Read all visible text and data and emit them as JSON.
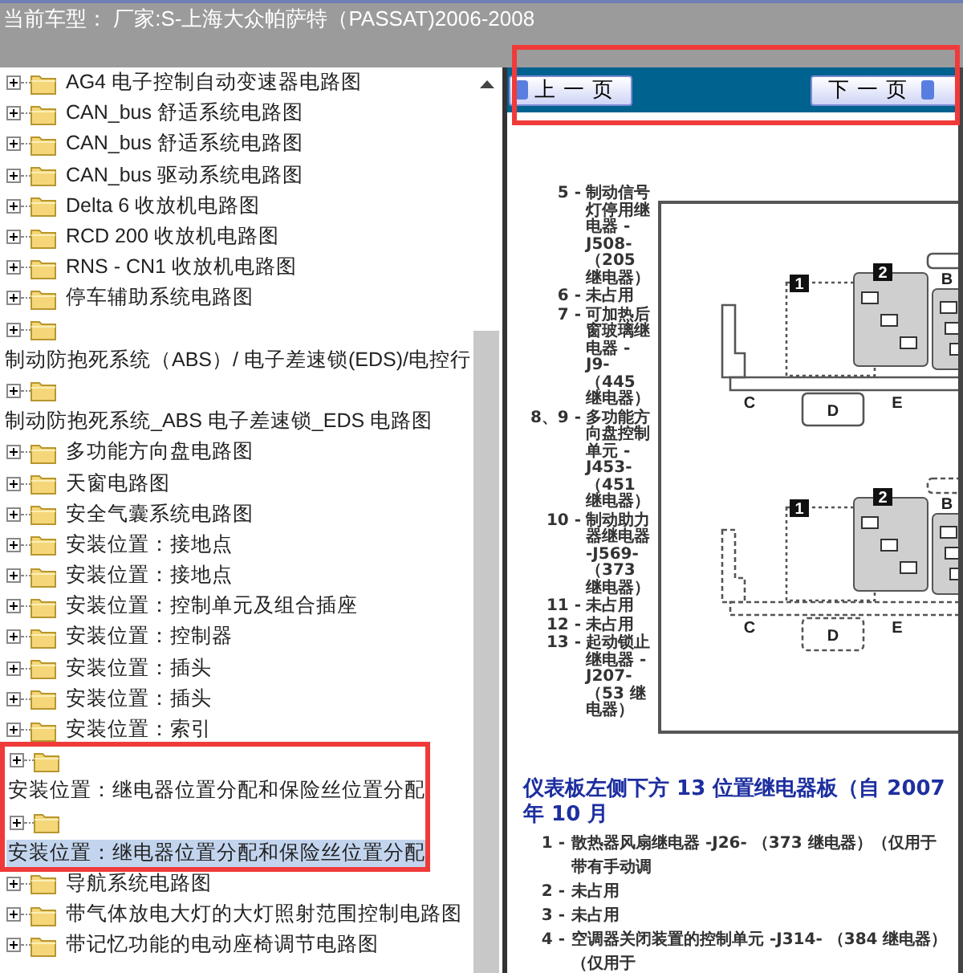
{
  "header": {
    "title": "当前车型： 厂家:S-上海大众帕萨特（PASSAT)2006-2008"
  },
  "tree": {
    "items": [
      {
        "label": "AG4 电子控制自动变速器电路图",
        "kind": "inline",
        "selected": false,
        "annotated": false
      },
      {
        "label": "CAN_bus 舒适系统电路图",
        "kind": "inline",
        "selected": false,
        "annotated": false
      },
      {
        "label": "CAN_bus 舒适系统电路图",
        "kind": "inline",
        "selected": false,
        "annotated": false
      },
      {
        "label": "CAN_bus 驱动系统电路图",
        "kind": "inline",
        "selected": false,
        "annotated": false
      },
      {
        "label": "Delta 6 收放机电路图",
        "kind": "inline",
        "selected": false,
        "annotated": false
      },
      {
        "label": "RCD 200 收放机电路图",
        "kind": "inline",
        "selected": false,
        "annotated": false
      },
      {
        "label": "RNS - CN1 收放机电路图",
        "kind": "inline",
        "selected": false,
        "annotated": false
      },
      {
        "label": "停车辅助系统电路图",
        "kind": "inline",
        "selected": false,
        "annotated": false
      },
      {
        "label": "制动防抱死系统（ABS）/ 电子差速锁(EDS)/电控行",
        "kind": "wrapped",
        "selected": false,
        "annotated": false
      },
      {
        "label": "制动防抱死系统_ABS 电子差速锁_EDS 电路图",
        "kind": "wrapped",
        "selected": false,
        "annotated": false
      },
      {
        "label": "多功能方向盘电路图",
        "kind": "inline",
        "selected": false,
        "annotated": false
      },
      {
        "label": "天窗电路图",
        "kind": "inline",
        "selected": false,
        "annotated": false
      },
      {
        "label": "安全气囊系统电路图",
        "kind": "inline",
        "selected": false,
        "annotated": false
      },
      {
        "label": "安装位置：接地点",
        "kind": "inline",
        "selected": false,
        "annotated": false
      },
      {
        "label": "安装位置：接地点",
        "kind": "inline",
        "selected": false,
        "annotated": false
      },
      {
        "label": "安装位置：控制单元及组合插座",
        "kind": "inline",
        "selected": false,
        "annotated": false
      },
      {
        "label": "安装位置：控制器",
        "kind": "inline",
        "selected": false,
        "annotated": false
      },
      {
        "label": "安装位置：插头",
        "kind": "inline",
        "selected": false,
        "annotated": false
      },
      {
        "label": "安装位置：插头",
        "kind": "inline",
        "selected": false,
        "annotated": false
      },
      {
        "label": "安装位置：索引",
        "kind": "inline",
        "selected": false,
        "annotated": false
      },
      {
        "label": "安装位置：继电器位置分配和保险丝位置分配",
        "kind": "wrapped",
        "selected": false,
        "annotated": true
      },
      {
        "label": "安装位置：继电器位置分配和保险丝位置分配",
        "kind": "wrapped",
        "selected": true,
        "annotated": true
      },
      {
        "label": "导航系统电路图",
        "kind": "inline",
        "selected": false,
        "annotated": false
      },
      {
        "label": "带气体放电大灯的大灯照射范围控制电路图",
        "kind": "inline",
        "selected": false,
        "annotated": false
      },
      {
        "label": "带记忆功能的电动座椅调节电路图",
        "kind": "inline",
        "selected": false,
        "annotated": false
      }
    ]
  },
  "viewer": {
    "toolbar": {
      "annotated": true,
      "buttons": [
        {
          "label": "上一页",
          "kind": "prev"
        },
        {
          "label": "下一页",
          "kind": "next"
        }
      ]
    },
    "legend": [
      {
        "number": "5 -",
        "text": "制动信号灯停用继电器 - J508- （205 继电器）"
      },
      {
        "number": "6 -",
        "text": "未占用"
      },
      {
        "number": "7 -",
        "text": "可加热后窗玻璃继电器 -J9- （445 继电器）"
      },
      {
        "number": "8、9 -",
        "text": "多功能方向盘控制单元 - J453- （451 继电器）"
      },
      {
        "number": "10 -",
        "text": "制动助力器继电器 -J569- （373 继电器）"
      },
      {
        "number": "11 -",
        "text": "未占用"
      },
      {
        "number": "12 -",
        "text": "未占用"
      },
      {
        "number": "13 -",
        "text": "起动锁止继电器 - J207- （53 继电器）"
      }
    ],
    "diagram": {
      "top_labels": [
        "1",
        "2",
        "B",
        "C",
        "D",
        "E"
      ],
      "bottom_labels": [
        "1",
        "2",
        "B",
        "C",
        "D",
        "E"
      ]
    },
    "section": {
      "heading": "仪表板左侧下方 13 位置继电器板（自 2007 年 10 月",
      "items": [
        {
          "number": "1 -",
          "text": "散热器风扇继电器 -J26- （373 继电器）（仅用于带有手动调"
        },
        {
          "number": "2 -",
          "text": "未占用"
        },
        {
          "number": "3 -",
          "text": "未占用"
        },
        {
          "number": "4 -",
          "text": "空调器关闭装置的控制单元 -J314- （384 继电器）（仅用于"
        }
      ]
    }
  }
}
